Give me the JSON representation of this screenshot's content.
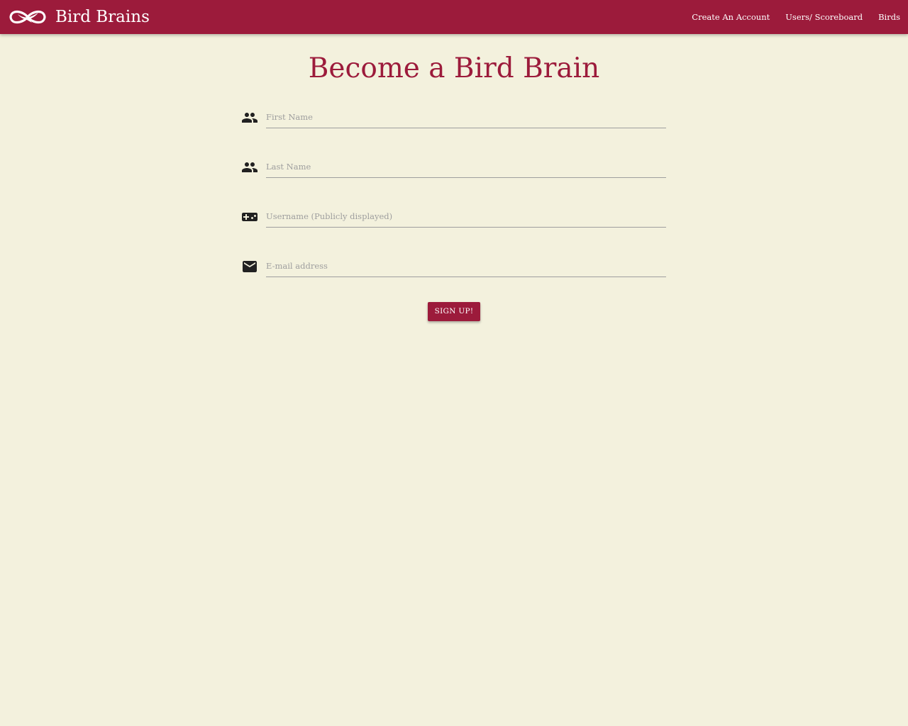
{
  "navbar": {
    "brand_name": "Bird Brains",
    "brand_icon": "bird-logo-icon",
    "links": [
      {
        "label": "Create An Account"
      },
      {
        "label": "Users/ Scoreboard"
      },
      {
        "label": "Birds"
      }
    ],
    "background_color": "#9c1b3b"
  },
  "page": {
    "title": "Become a Bird Brain",
    "background_color": "#f3f1dd",
    "accent_color": "#9c1b3b"
  },
  "form": {
    "fields": [
      {
        "icon": "people-icon",
        "placeholder": "First Name",
        "value": ""
      },
      {
        "icon": "people-icon",
        "placeholder": "Last Name",
        "value": ""
      },
      {
        "icon": "gamepad-icon",
        "placeholder": "Username (Publicly displayed)",
        "value": ""
      },
      {
        "icon": "mail-icon",
        "placeholder": "E-mail address",
        "value": ""
      }
    ],
    "submit_label": "SIGN UP!"
  }
}
